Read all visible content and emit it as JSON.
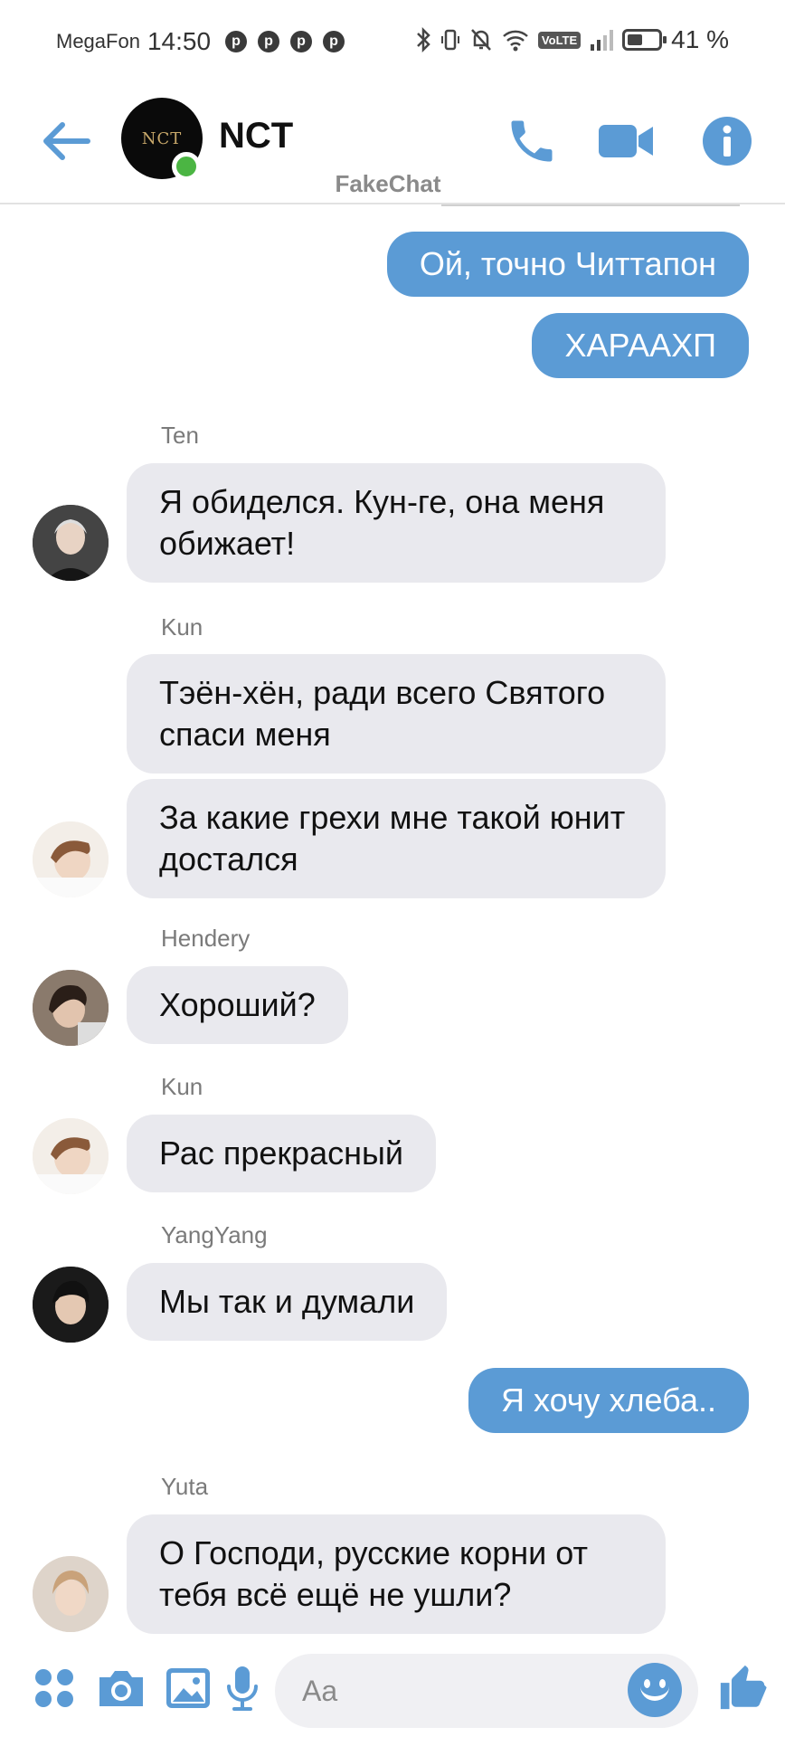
{
  "colors": {
    "accent": "#5b9bd5",
    "incoming_bubble": "#e9e9ee",
    "online": "#4bb543"
  },
  "status_bar": {
    "carrier": "MegaFon",
    "time": "14:50",
    "pin_glyph": "p",
    "battery": "41 %"
  },
  "header": {
    "title": "NCT",
    "avatar_logo": "NCT",
    "watermark": "FakeChat"
  },
  "messages": {
    "m1": "Ой, точно Читтапон",
    "m2": "ХАРААХП",
    "s3": "Ten",
    "m3": "Я обиделся. Кун-ге, она меня обижает!",
    "s4": "Kun",
    "m4": "Тэён-хён, ради всего Святого спаси меня",
    "m5": "За какие грехи мне такой юнит достался",
    "s6": "Hendery",
    "m6": "Хороший?",
    "s7": "Kun",
    "m7": "Рас прекрасный",
    "s8": "YangYang",
    "m8": "Мы так и думали",
    "m9": "Я хочу хлеба..",
    "s10": "Yuta",
    "m10": "О Господи, русские корни от тебя всё ещё не ушли?"
  },
  "composer": {
    "placeholder": "Aa"
  }
}
